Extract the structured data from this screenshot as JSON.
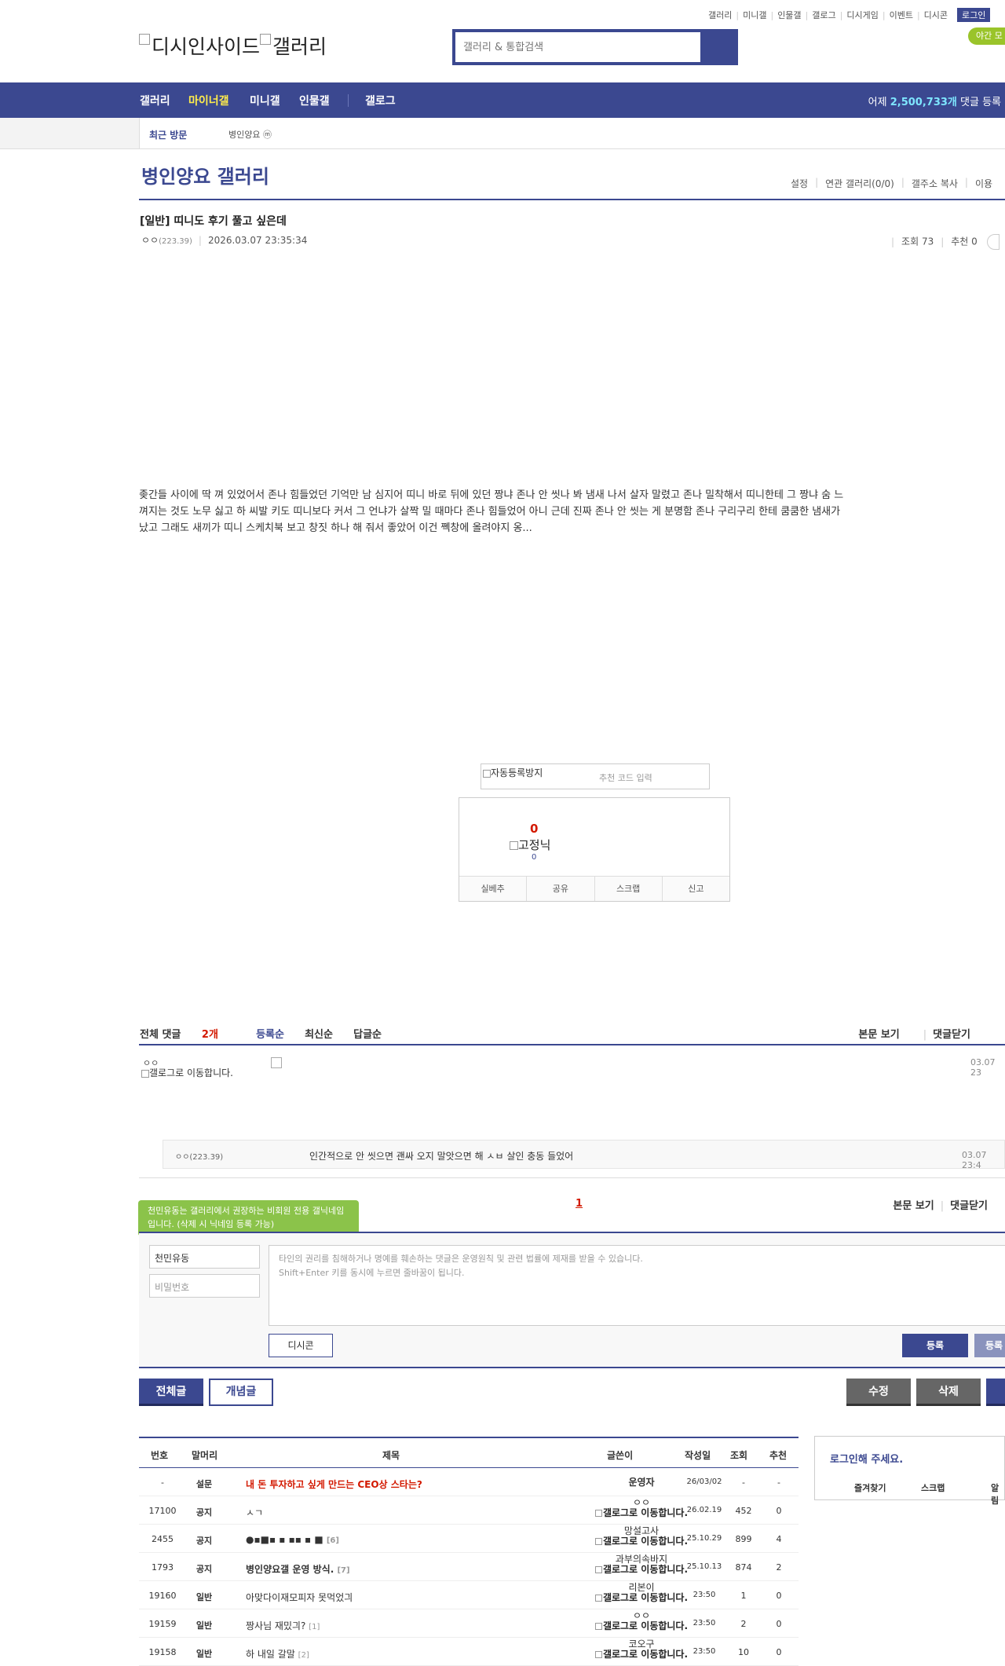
{
  "top_links": [
    "갤러리",
    "미니갤",
    "인물갤",
    "갤로그",
    "디시게임",
    "이벤트",
    "디시콘"
  ],
  "login_label": "로그인",
  "night_mode_label": "야간 모",
  "logo": {
    "site_alt": "디시인사이드",
    "gallery_alt": "갤러리"
  },
  "search": {
    "placeholder": "갤러리 & 통합검색"
  },
  "nav": {
    "items": [
      "갤러리",
      "마이너갤",
      "미니갤",
      "인물갤",
      "갤로그"
    ],
    "active": "마이너갤",
    "stat_prefix": "어제 ",
    "stat_value": "2,500,733개",
    "stat_suffix": " 댓글 등록"
  },
  "recent": {
    "label": "최근 방문",
    "gallery": "병인양요",
    "badge": "ⓜ"
  },
  "gallery": {
    "title": "병인양요 갤러리",
    "tools": [
      "설정",
      "연관 갤러리(0/0)",
      "갤주소 복사",
      "이용"
    ]
  },
  "post": {
    "title": "[일반] 띠니도 후기 풀고 싶은데",
    "writer": "ㅇㅇ",
    "ip": "(223.39)",
    "date": "2026.03.07 23:35:34",
    "views": "조회 73",
    "recommend": "추천 0",
    "body": "좆간들 사이에 딱 껴 있었어서 존나 힘들었던 기억만 남 심지어 띠니 바로 뒤에 있던 짱냐 존나 안 씻나 봐 냄새 나서 살자 말렸고 존나 밀착해서 띠니한테 그 짱냐 숨 느껴지는 것도 노무 싫고 하 씨발 키도 띠니보다 커서 그 언냐가 살짝 밀 때마다 존나 힘들었어 아니 근데 진짜 존나 안 씻는 게 분명함 존나 구리구리 한테 쿰쿰한 냄새가 났고 그래도 새끼가 띠니 스케치북 보고 창짓 하나 해 줘서 좋았어 이건 쪡창에 올려야지 옹..."
  },
  "captcha": {
    "img_alt": "자동등록방지",
    "placeholder": "추천 코드 입력"
  },
  "recommend_box": {
    "count": "0",
    "fixed_alt": "고정닉",
    "fixed_count": "0",
    "buttons": [
      "실베추",
      "공유",
      "스크랩",
      "신고"
    ]
  },
  "comments": {
    "total_label": "전체 댓글",
    "count": "2개",
    "sorts": [
      "등록순",
      "최신순",
      "답글순"
    ],
    "right_links": [
      "본문 보기",
      "댓글닫기"
    ],
    "first": {
      "name": "ㅇㅇ",
      "img_alt": "갤로그로 이동합니다.",
      "date": "03.07 23"
    },
    "reply": {
      "name": "ㅇㅇ(223.39)",
      "text": "인간적으로 안 씻으면 괜싸 오지 말앗으면 해 ㅅㅂ 살인 충동 들었어",
      "date": "03.07 23:4"
    },
    "page": "1",
    "tooltip": "천민유동는 갤러리에서 권장하는 비회원 전용 갤닉네임입니다. (삭제 시 닉네임 등록 가능)"
  },
  "form": {
    "nick_value": "천민유동",
    "pw_placeholder": "비밀번호",
    "text_line1": "타인의 권리를 침해하거나 명예를 훼손하는 댓글은 운영원칙 및 관련 법률에 제재를 받을 수 있습니다.",
    "text_line2": "Shift+Enter 키를 동시에 누르면 줄바꿈이 됩니다.",
    "dccon": "디시콘",
    "submit": "등록",
    "submit2": "등록"
  },
  "buttons": {
    "all": "전체글",
    "concept": "개념글",
    "edit": "수정",
    "delete": "삭제"
  },
  "list": {
    "headers": [
      "번호",
      "말머리",
      "제목",
      "글쓴이",
      "작성일",
      "조회",
      "추천"
    ],
    "rows": [
      {
        "no": "-",
        "head": "설문",
        "title": "내 돈 투자하고 싶게 만드는 CEO상 스타는?",
        "reply": "",
        "writer": "운영자",
        "img": "",
        "date": "26/03/02",
        "views": "-",
        "rec": "-",
        "kind": "ad"
      },
      {
        "no": "17100",
        "head": "공지",
        "title": "ㅅㄱ",
        "reply": "",
        "writer": "ㅇㅇ",
        "img": "갤로그로 이동합니다.",
        "date": "26.02.19",
        "views": "452",
        "rec": "0",
        "kind": "normal"
      },
      {
        "no": "2455",
        "head": "공지",
        "title": "●▪■▪ ▪ ▪▪ ▪ ■",
        "reply": "[6]",
        "writer": "망설고사",
        "img": "갤로그로 이동합니다.",
        "date": "25.10.29",
        "views": "899",
        "rec": "4",
        "kind": "notice"
      },
      {
        "no": "1793",
        "head": "공지",
        "title": "병인양요갤 운영 방식.",
        "reply": "[7]",
        "writer": "과부의속바지",
        "img": "갤로그로 이동합니다.",
        "date": "25.10.13",
        "views": "874",
        "rec": "2",
        "kind": "notice"
      },
      {
        "no": "19160",
        "head": "일반",
        "title": "아맞다이재모피자 못먹었긔",
        "reply": "",
        "writer": "리본이",
        "img": "갤로그로 이동합니다.",
        "date": "23:50",
        "views": "1",
        "rec": "0",
        "kind": "normal"
      },
      {
        "no": "19159",
        "head": "일반",
        "title": "짱사님 재밌긔?",
        "reply": "[1]",
        "writer": "ㅇㅇ",
        "img": "갤로그로 이동합니다.",
        "date": "23:50",
        "views": "2",
        "rec": "0",
        "kind": "normal"
      },
      {
        "no": "19158",
        "head": "일반",
        "title": "하 내일 갈말",
        "reply": "[2]",
        "writer": "코오구",
        "img": "갤로그로 이동합니다.",
        "date": "23:50",
        "views": "10",
        "rec": "0",
        "kind": "normal"
      }
    ]
  },
  "login_box": {
    "title": "로그인해 주세요.",
    "links": [
      "즐겨찾기",
      "스크랩",
      "알림"
    ]
  },
  "colors": {
    "primary": "#3b4890",
    "accent_red": "#d31900",
    "nav_active": "#ffed4b",
    "night_green": "#9ac42a"
  }
}
